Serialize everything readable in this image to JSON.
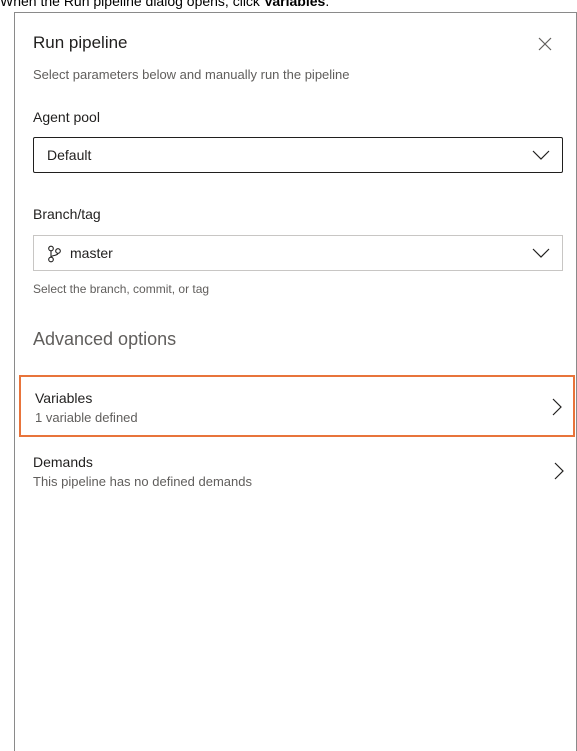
{
  "caption": {
    "prefix": "When the Run pipeline dialog opens, click ",
    "bold": "Variables",
    "suffix": "."
  },
  "dialog": {
    "title": "Run pipeline",
    "subtitle": "Select parameters below and manually run the pipeline",
    "agent_pool": {
      "label": "Agent pool",
      "value": "Default"
    },
    "branch": {
      "label": "Branch/tag",
      "value": "master",
      "hint": "Select the branch, commit, or tag"
    },
    "advanced": {
      "title": "Advanced options",
      "items": [
        {
          "title": "Variables",
          "subtitle": "1 variable defined"
        },
        {
          "title": "Demands",
          "subtitle": "This pipeline has no defined demands"
        }
      ]
    }
  },
  "colors": {
    "highlight": "#e8743b",
    "text": "#201f1e",
    "muted": "#605e5c"
  },
  "icons": {
    "close": "close-icon",
    "chevron_down": "chevron-down-icon",
    "chevron_right": "chevron-right-icon",
    "branch": "branch-icon"
  }
}
